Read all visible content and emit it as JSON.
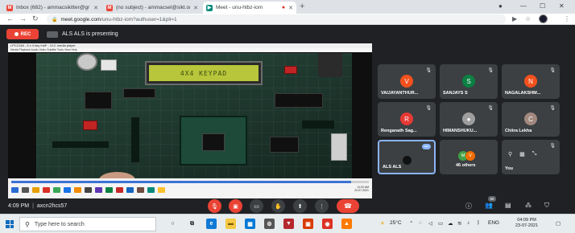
{
  "browser": {
    "tabs": [
      {
        "title": "Inbox (682) - ammacsikitter@gr",
        "favicon": "M",
        "color": "#ea4335"
      },
      {
        "title": "(no subject) - ammacsel@sikt.org",
        "favicon": "M",
        "color": "#ea4335"
      },
      {
        "title": "Meet - unu-htbz-iom",
        "favicon": "▶",
        "color": "#00897b"
      }
    ],
    "new_tab": "+",
    "url_host": "meet.google.com",
    "url_path": "/unu-htbz-iom?authuser=1&pli=1"
  },
  "meet": {
    "rec_label": "REC",
    "presenting_text": "ALS ALS is presenting",
    "shared_screen": {
      "window_title": "LPC2148 - 3 x 4 key Inkf* - VLC media player",
      "menu": "Media  Playback  Audio  Video  Subtitle  Tools  View  Help",
      "lcd_text": "4X4 KEYPAD",
      "seek_progress": 0.95,
      "clock_time": "11:02 AM",
      "clock_date": "22-07-2021"
    },
    "participants": [
      {
        "name": "VAIJAYANTHUR...",
        "initial": "V",
        "color": "#f4511e"
      },
      {
        "name": "SANJAYS S",
        "initial": "S",
        "color": "#0b8043"
      },
      {
        "name": "NAGALAKSHM...",
        "initial": "N",
        "color": "#f4511e"
      },
      {
        "name": "Renganath Sag...",
        "initial": "R",
        "color": "#e53935"
      },
      {
        "name": "HIMANSHUKU...",
        "initial": "",
        "color": "#9e9e9e"
      },
      {
        "name": "Chitra Lekha",
        "initial": "C",
        "color": "#a1887f"
      }
    ],
    "self_tile": {
      "name": "ALS ALS",
      "more": "•••"
    },
    "others_tile": {
      "label": "46 others",
      "initials": [
        "M",
        "V"
      ],
      "colors": [
        "#43a047",
        "#ef6c00"
      ]
    },
    "you_tile": {
      "label": "You"
    },
    "time": "4:09 PM",
    "meeting_code": "axcn2hcs57",
    "people_count": "55"
  },
  "taskbar": {
    "search_placeholder": "Type here to search",
    "weather": "25°C",
    "language": "ENG",
    "time": "04:09 PM",
    "date": "23-07-2021"
  }
}
